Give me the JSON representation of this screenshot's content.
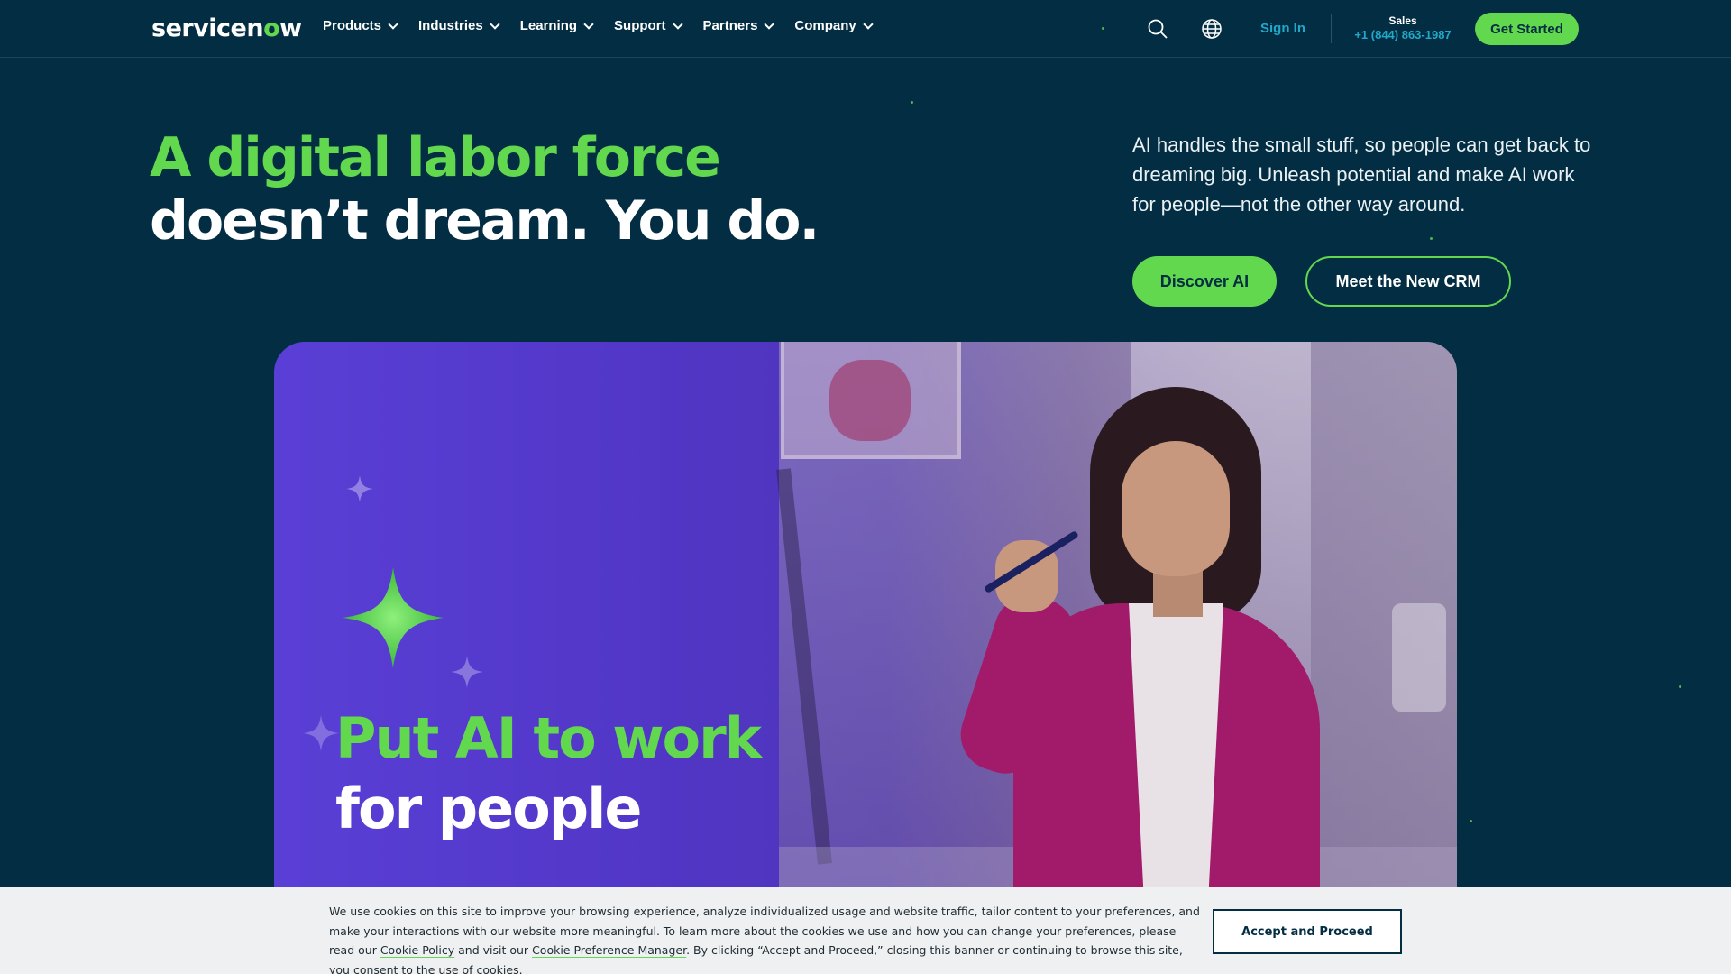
{
  "header": {
    "logo": {
      "prefix": "servicen",
      "accent": "o",
      "suffix": "w"
    },
    "nav": [
      {
        "label": "Products"
      },
      {
        "label": "Industries"
      },
      {
        "label": "Learning"
      },
      {
        "label": "Support"
      },
      {
        "label": "Partners"
      },
      {
        "label": "Company"
      }
    ],
    "search_icon": "search-icon",
    "globe_icon": "globe-icon",
    "sign_in": "Sign In",
    "sales_label": "Sales",
    "sales_phone": "+1 (844) 863-1987",
    "get_started": "Get Started"
  },
  "hero": {
    "title_line1": "A digital labor force",
    "title_line2": "doesn’t dream. You do.",
    "description": "AI handles the small stuff, so people can get back to dreaming big. Unleash potential and make AI work for people—not the other way around.",
    "primary_cta": "Discover AI",
    "secondary_cta": "Meet the New CRM"
  },
  "banner": {
    "title_line1": "Put AI to work",
    "title_line2": "for people"
  },
  "cookie": {
    "text_part1": "We use cookies on this site to improve your browsing experience, analyze individualized usage and website traffic, tailor content to your preferences, and make your interactions with our website more meaningful. To learn more about the cookies we use and how you can change your preferences, please read our ",
    "cookie_policy_link": "Cookie Policy",
    "text_part2": " and visit our ",
    "preference_link": "Cookie Preference Manager",
    "text_part3": ". By clicking “Accept and Proceed,” closing this banner or continuing to browse this site, you consent to the use of cookies.",
    "accept_button": "Accept and Proceed"
  },
  "colors": {
    "background": "#032d42",
    "accent_green": "#62d84e",
    "link_blue": "#20a9c9",
    "banner_purple": "#5a3fd6",
    "cookie_bg": "#eef0f1"
  }
}
